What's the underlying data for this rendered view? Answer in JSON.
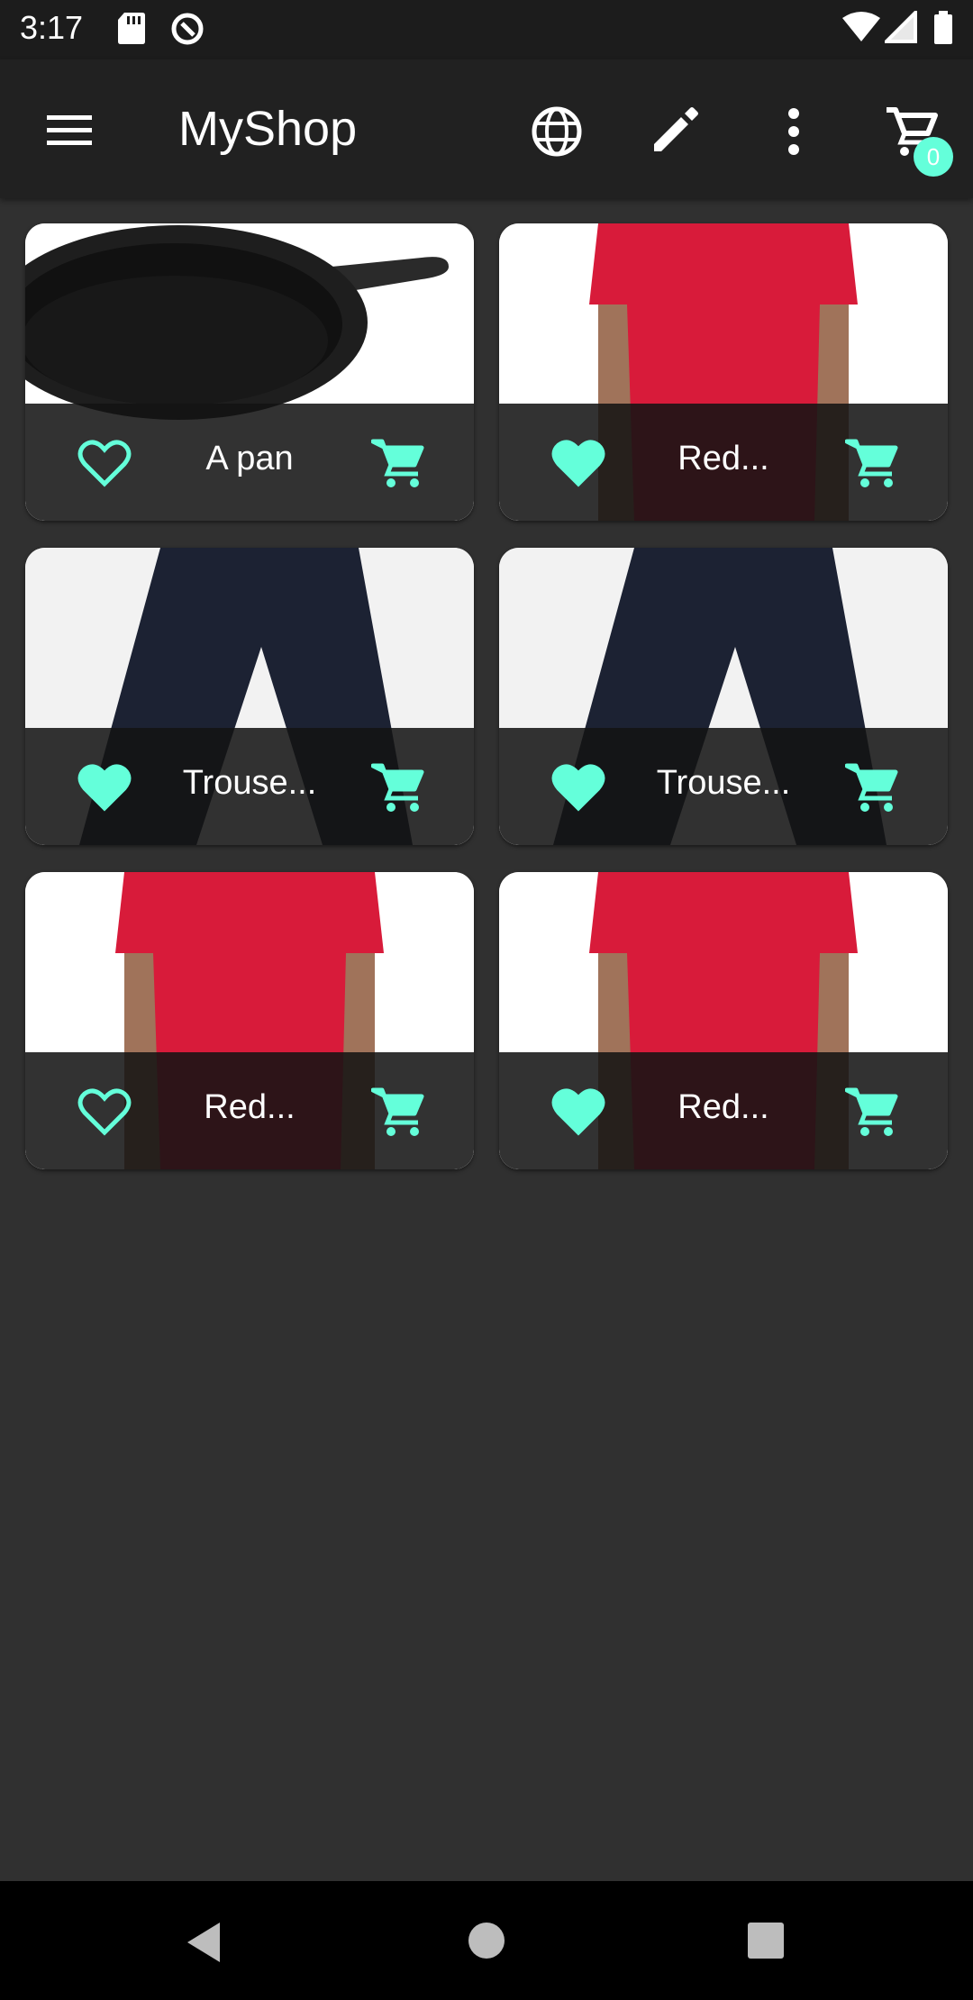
{
  "status_bar": {
    "time": "3:17",
    "icons": [
      "sd-card-icon",
      "sync-icon",
      "wifi-icon",
      "signal-icon",
      "battery-icon"
    ]
  },
  "app_bar": {
    "menu_icon": "menu-icon",
    "title": "MyShop",
    "actions": [
      "globe-icon",
      "edit-icon",
      "more-vertical-icon",
      "cart-icon"
    ],
    "cart_count": "0"
  },
  "products": [
    {
      "name": "A pan",
      "favorite": false,
      "image": "pan"
    },
    {
      "name": "Red...",
      "favorite": true,
      "image": "red-shirt"
    },
    {
      "name": "Trouse...",
      "favorite": true,
      "image": "trousers"
    },
    {
      "name": "Trouse...",
      "favorite": true,
      "image": "trousers"
    },
    {
      "name": "Red...",
      "favorite": false,
      "image": "red-shirt"
    },
    {
      "name": "Red...",
      "favorite": true,
      "image": "red-shirt"
    }
  ],
  "nav_bar": {
    "buttons": [
      "back-icon",
      "home-icon",
      "recents-icon"
    ]
  },
  "colors": {
    "accent": "#64ffda",
    "background": "#303030",
    "app_bar": "#212121",
    "status_bar": "#1c1c1c",
    "card_footer": "#141414"
  }
}
